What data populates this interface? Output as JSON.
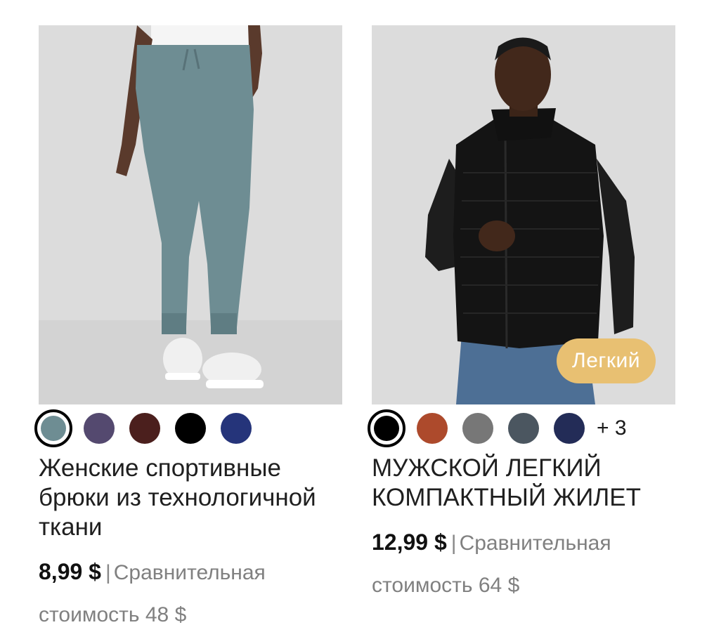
{
  "products": [
    {
      "swatches": [
        {
          "color": "#6e8d93",
          "name": "teal-gray",
          "selected": true
        },
        {
          "color": "#54496f",
          "name": "purple"
        },
        {
          "color": "#4b1f1d",
          "name": "burgundy"
        },
        {
          "color": "#000000",
          "name": "black"
        },
        {
          "color": "#25347a",
          "name": "navy"
        }
      ],
      "title": "Женские спортивные брюки из технологичной ткани",
      "price": "8,99 $",
      "separator": "|",
      "compare_label": "Сравнительная стоимость 48 $"
    },
    {
      "badge": "Легкий",
      "swatches": [
        {
          "color": "#000000",
          "name": "black",
          "selected": true
        },
        {
          "color": "#ad4a2c",
          "name": "rust"
        },
        {
          "color": "#777777",
          "name": "gray"
        },
        {
          "color": "#4b5660",
          "name": "slate"
        },
        {
          "color": "#232c57",
          "name": "navy"
        }
      ],
      "more_colors": "+ 3",
      "title": "МУЖСКОЙ ЛЕГКИЙ КОМПАКТНЫЙ ЖИЛЕТ",
      "price": "12,99 $",
      "separator": "|",
      "compare_label": "Сравнительная стоимость 64 $"
    }
  ]
}
